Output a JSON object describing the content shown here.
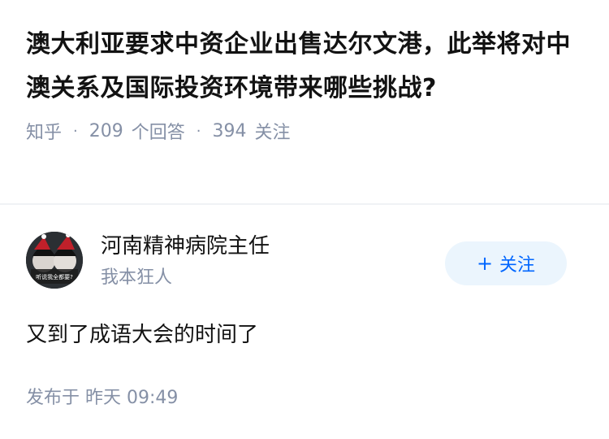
{
  "question": {
    "title": "澳大利亚要求中资企业出售达尔文港，此举将对中澳关系及国际投资环境带来哪些挑战?",
    "source": "知乎",
    "answer_count": "209",
    "answer_label": "个回答",
    "follow_count": "394",
    "follow_label": "关注"
  },
  "answer": {
    "author_name": "河南精神病院主任",
    "author_bio": "我本狂人",
    "avatar_caption": "听说我全都要?",
    "follow_button": {
      "icon": "plus-icon",
      "label": "关注"
    },
    "content": "又到了成语大会的时间了",
    "time_label": "发布于",
    "time_value": "昨天 09:49"
  },
  "colors": {
    "meta_gray": "#8590a6",
    "follow_blue": "#0066ff",
    "follow_bg": "#ebf5fd",
    "divider": "#f0f2f5"
  }
}
